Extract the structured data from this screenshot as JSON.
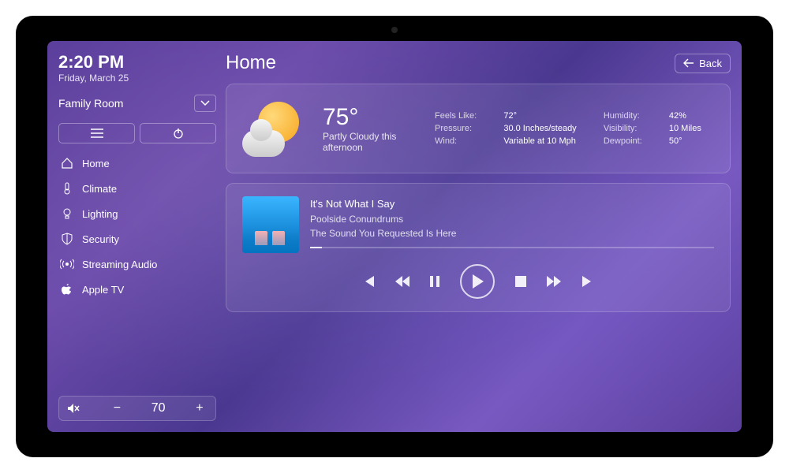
{
  "clock": {
    "time": "2:20 PM",
    "date": "Friday, March 25"
  },
  "room": {
    "label": "Family Room"
  },
  "nav": {
    "items": [
      {
        "label": "Home"
      },
      {
        "label": "Climate"
      },
      {
        "label": "Lighting"
      },
      {
        "label": "Security"
      },
      {
        "label": "Streaming Audio"
      },
      {
        "label": "Apple TV"
      }
    ]
  },
  "volume": {
    "level": "70"
  },
  "header": {
    "title": "Home",
    "back": "Back"
  },
  "weather": {
    "temp": "75°",
    "condition": "Partly Cloudy this afternoon",
    "feels_like_label": "Feels Like:",
    "feels_like": "72°",
    "humidity_label": "Humidity:",
    "humidity": "42%",
    "pressure_label": "Pressure:",
    "pressure": "30.0 Inches/steady",
    "visibility_label": "Visibility:",
    "visibility": "10 Miles",
    "wind_label": "Wind:",
    "wind": "Variable at 10 Mph",
    "dewpoint_label": "Dewpoint:",
    "dewpoint": "50°"
  },
  "media": {
    "title": "It's Not What I Say",
    "artist": "Poolside Conundrums",
    "album": "The Sound You Requested Is Here"
  }
}
